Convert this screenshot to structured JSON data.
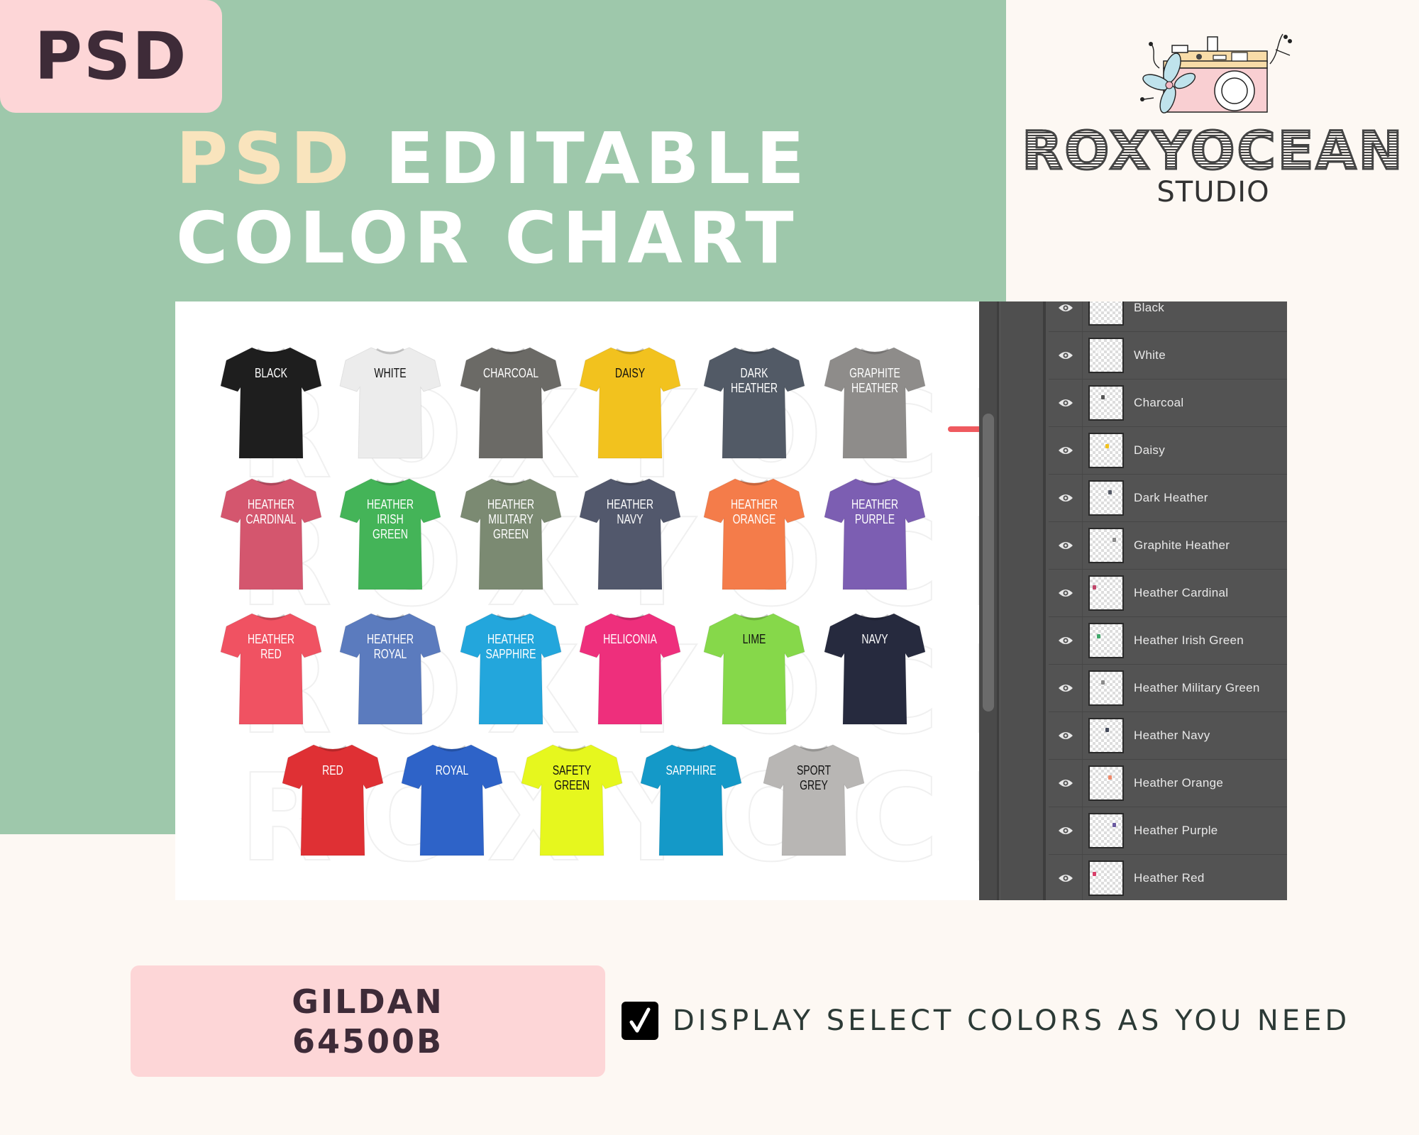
{
  "badge": {
    "label": "PSD"
  },
  "headline": {
    "accent": "PSD",
    "line1_rest": "EDITABLE",
    "line2": "COLOR CHART"
  },
  "logo": {
    "name": "ROXYOCEAN",
    "subtitle": "STUDIO"
  },
  "watermark": "ROXYOCEAN",
  "shirts": [
    {
      "label": "BLACK",
      "color": "#1e1e1e",
      "text_color": "#ffffff"
    },
    {
      "label": "WHITE",
      "color": "#ececec",
      "text_color": "#111111"
    },
    {
      "label": "CHARCOAL",
      "color": "#6b6a66",
      "text_color": "#ffffff"
    },
    {
      "label": "DAISY",
      "color": "#f2c21e",
      "text_color": "#111111"
    },
    {
      "label": "DARK\nHEATHER",
      "color": "#525a66",
      "text_color": "#ffffff"
    },
    {
      "label": "GRAPHITE\nHEATHER",
      "color": "#8e8c8a",
      "text_color": "#ffffff"
    },
    {
      "label": "HEATHER\nCARDINAL",
      "color": "#d4566e",
      "text_color": "#ffffff"
    },
    {
      "label": "HEATHER\nIRISH\nGREEN",
      "color": "#44b458",
      "text_color": "#ffffff"
    },
    {
      "label": "HEATHER\nMILITARY\nGREEN",
      "color": "#7b8a72",
      "text_color": "#ffffff"
    },
    {
      "label": "HEATHER\nNAVY",
      "color": "#52586c",
      "text_color": "#ffffff"
    },
    {
      "label": "HEATHER\nORANGE",
      "color": "#f47c4a",
      "text_color": "#ffffff"
    },
    {
      "label": "HEATHER\nPURPLE",
      "color": "#7c5eb2",
      "text_color": "#ffffff"
    },
    {
      "label": "HEATHER\nRED",
      "color": "#f05262",
      "text_color": "#ffffff"
    },
    {
      "label": "HEATHER\nROYAL",
      "color": "#5b7bbe",
      "text_color": "#ffffff"
    },
    {
      "label": "HEATHER\nSAPPHIRE",
      "color": "#23a6dc",
      "text_color": "#ffffff"
    },
    {
      "label": "HELICONIA",
      "color": "#ee2f7c",
      "text_color": "#ffffff"
    },
    {
      "label": "LIME",
      "color": "#86d84a",
      "text_color": "#111111"
    },
    {
      "label": "NAVY",
      "color": "#262a3e",
      "text_color": "#ffffff"
    },
    {
      "label": "RED",
      "color": "#df3034",
      "text_color": "#ffffff"
    },
    {
      "label": "ROYAL",
      "color": "#2e63c8",
      "text_color": "#ffffff"
    },
    {
      "label": "SAFETY\nGREEN",
      "color": "#e6f71e",
      "text_color": "#111111"
    },
    {
      "label": "SAPPHIRE",
      "color": "#1499c8",
      "text_color": "#ffffff"
    },
    {
      "label": "SPORT\nGREY",
      "color": "#b8b6b4",
      "text_color": "#111111"
    }
  ],
  "layers_panel": {
    "layers": [
      {
        "name": "Black",
        "visible": true,
        "thumb_color": "#222222"
      },
      {
        "name": "White",
        "visible": true,
        "thumb_color": "#f4f4f4"
      },
      {
        "name": "Charcoal",
        "visible": true,
        "thumb_color": "#555555"
      },
      {
        "name": "Daisy",
        "visible": true,
        "thumb_color": "#f2c21e"
      },
      {
        "name": "Dark Heather",
        "visible": true,
        "thumb_color": "#555a66"
      },
      {
        "name": "Graphite Heather",
        "visible": true,
        "thumb_color": "#888888"
      },
      {
        "name": "Heather Cardinal",
        "visible": true,
        "thumb_color": "#c2466a"
      },
      {
        "name": "Heather Irish Green",
        "visible": true,
        "thumb_color": "#3fa86a"
      },
      {
        "name": "Heather Military Green",
        "visible": true,
        "thumb_color": "#8a8a8a"
      },
      {
        "name": "Heather Navy",
        "visible": true,
        "thumb_color": "#444a5a"
      },
      {
        "name": "Heather Orange",
        "visible": true,
        "thumb_color": "#f08a6a"
      },
      {
        "name": "Heather Purple",
        "visible": true,
        "thumb_color": "#6a5aa0"
      },
      {
        "name": "Heather Red",
        "visible": true,
        "thumb_color": "#d8406a"
      }
    ]
  },
  "footer": {
    "product_line1": "GILDAN",
    "product_line2": "64500B",
    "checkbox_checked": true,
    "tagline": "DISPLAY SELECT COLORS AS YOU NEED"
  },
  "colors": {
    "green_bg": "#9ec8ab",
    "pink": "#fdd6d7",
    "cream": "#fdf8f3",
    "dark_plum": "#3e2b38",
    "accent_yellow": "#f9e4bd",
    "arrow_red": "#ef5a5f",
    "panel_gray": "#535353"
  }
}
